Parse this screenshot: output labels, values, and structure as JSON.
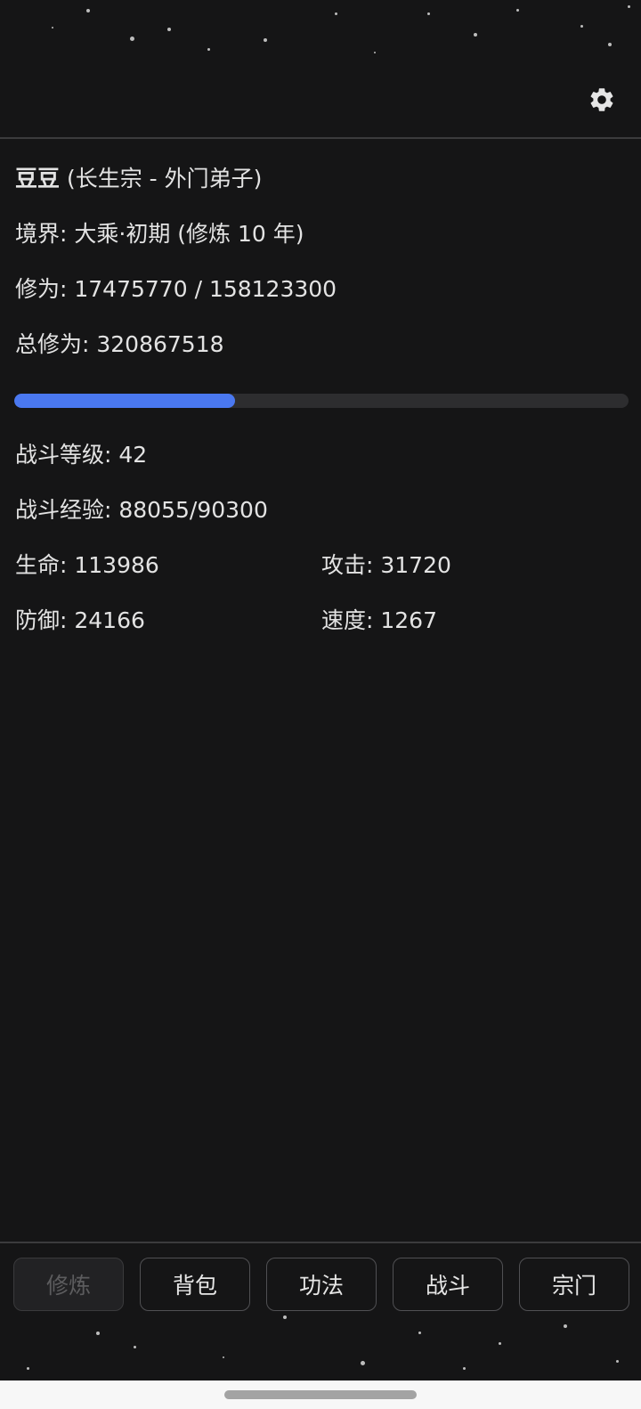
{
  "header": {
    "settings_icon": "gear-icon"
  },
  "player": {
    "name": "豆豆",
    "affiliation": " (长生宗 - 外门弟子)",
    "realm_label": "境界: ",
    "realm_value": "大乘·初期 (修炼 10 年)",
    "cultivation_label": "修为: ",
    "cultivation_value": "17475770 / 158123300",
    "total_cultivation_label": "总修为: ",
    "total_cultivation_value": "320867518",
    "cultivation_progress": 0.36
  },
  "combat": {
    "level_label": "战斗等级: ",
    "level_value": "42",
    "exp_label": "战斗经验: ",
    "exp_value": "88055/90300",
    "hp_label": "生命: ",
    "hp_value": "113986",
    "attack_label": "攻击: ",
    "attack_value": "31720",
    "defense_label": "防御: ",
    "defense_value": "24166",
    "speed_label": "速度: ",
    "speed_value": "1267"
  },
  "nav": {
    "cultivate": "修炼",
    "bag": "背包",
    "skills": "功法",
    "battle": "战斗",
    "sect": "宗门",
    "active": "cultivate"
  },
  "colors": {
    "background": "#151516",
    "progress_fill": "#4a78f0",
    "progress_track": "#2d2d2f",
    "text": "#e3e3e3"
  }
}
